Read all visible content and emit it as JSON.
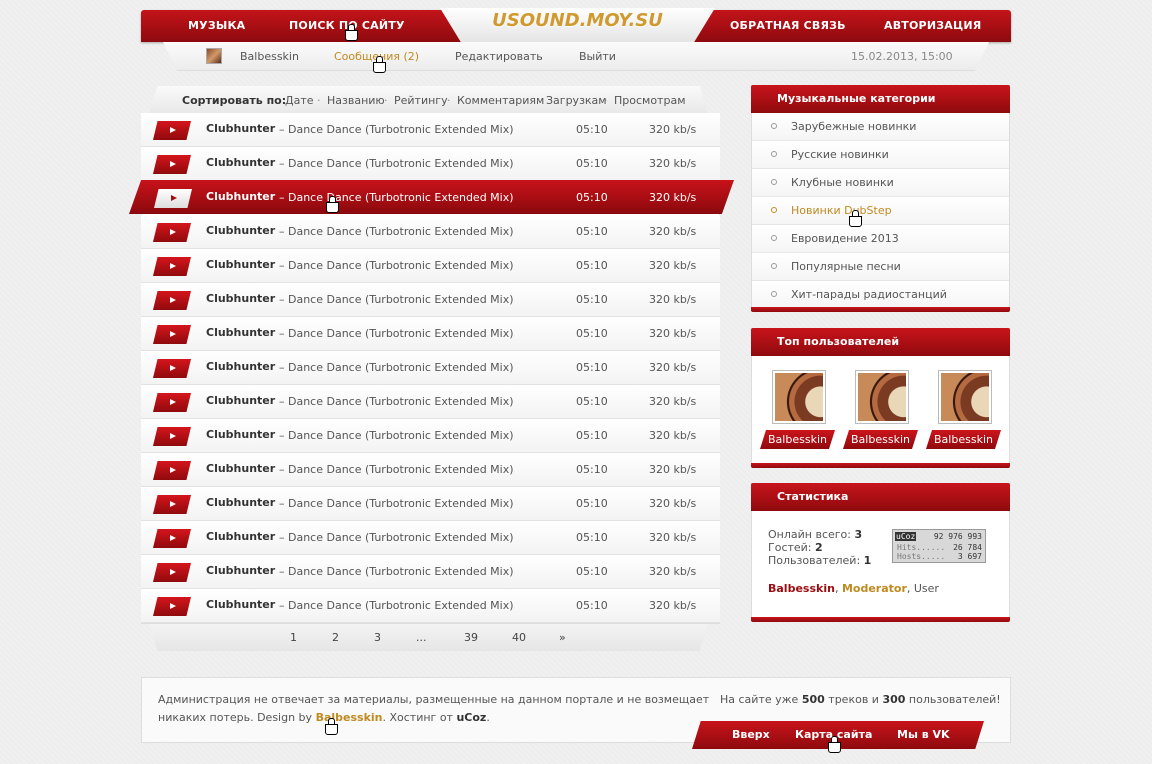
{
  "nav": {
    "music": "МУЗЫКА",
    "search": "ПОИСК ПО САЙТУ",
    "logo": "USOUND.MOY.SU",
    "feedback": "ОБРАТНАЯ СВЯЗЬ",
    "auth": "АВТОРИЗАЦИЯ"
  },
  "userbar": {
    "username": "Balbesskin",
    "messages": "Сообщения (2)",
    "edit": "Редактировать",
    "logout": "Выйти",
    "datetime": "15.02.2013, 15:00"
  },
  "sort": {
    "label": "Сортировать по:",
    "options": [
      "Дате",
      "Названию",
      "Рейтингу",
      "Комментариям",
      "Загрузкам",
      "Просмотрам"
    ]
  },
  "tracks": [
    {
      "artist": "Clubhunter",
      "title": "– Dance Dance (Turbotronic Extended Mix)",
      "duration": "05:10",
      "bitrate": "320 kb/s"
    },
    {
      "artist": "Clubhunter",
      "title": "– Dance Dance (Turbotronic Extended Mix)",
      "duration": "05:10",
      "bitrate": "320 kb/s"
    },
    {
      "artist": "Clubhunter",
      "title": "– Dance Dance (Turbotronic Extended Mix)",
      "duration": "05:10",
      "bitrate": "320 kb/s",
      "active": true
    },
    {
      "artist": "Clubhunter",
      "title": "– Dance Dance (Turbotronic Extended Mix)",
      "duration": "05:10",
      "bitrate": "320 kb/s"
    },
    {
      "artist": "Clubhunter",
      "title": "– Dance Dance (Turbotronic Extended Mix)",
      "duration": "05:10",
      "bitrate": "320 kb/s"
    },
    {
      "artist": "Clubhunter",
      "title": "– Dance Dance (Turbotronic Extended Mix)",
      "duration": "05:10",
      "bitrate": "320 kb/s"
    },
    {
      "artist": "Clubhunter",
      "title": "– Dance Dance (Turbotronic Extended Mix)",
      "duration": "05:10",
      "bitrate": "320 kb/s"
    },
    {
      "artist": "Clubhunter",
      "title": "– Dance Dance (Turbotronic Extended Mix)",
      "duration": "05:10",
      "bitrate": "320 kb/s"
    },
    {
      "artist": "Clubhunter",
      "title": "– Dance Dance (Turbotronic Extended Mix)",
      "duration": "05:10",
      "bitrate": "320 kb/s"
    },
    {
      "artist": "Clubhunter",
      "title": "– Dance Dance (Turbotronic Extended Mix)",
      "duration": "05:10",
      "bitrate": "320 kb/s"
    },
    {
      "artist": "Clubhunter",
      "title": "– Dance Dance (Turbotronic Extended Mix)",
      "duration": "05:10",
      "bitrate": "320 kb/s"
    },
    {
      "artist": "Clubhunter",
      "title": "– Dance Dance (Turbotronic Extended Mix)",
      "duration": "05:10",
      "bitrate": "320 kb/s"
    },
    {
      "artist": "Clubhunter",
      "title": "– Dance Dance (Turbotronic Extended Mix)",
      "duration": "05:10",
      "bitrate": "320 kb/s"
    },
    {
      "artist": "Clubhunter",
      "title": "– Dance Dance (Turbotronic Extended Mix)",
      "duration": "05:10",
      "bitrate": "320 kb/s"
    },
    {
      "artist": "Clubhunter",
      "title": "– Dance Dance (Turbotronic Extended Mix)",
      "duration": "05:10",
      "bitrate": "320 kb/s"
    }
  ],
  "pager": [
    "1",
    "2",
    "3",
    "...",
    "39",
    "40",
    "»"
  ],
  "categories": {
    "title": "Музыкальные категории",
    "items": [
      "Зарубежные новинки",
      "Русские новинки",
      "Клубные новинки",
      "Новинки DubStep",
      "Евровидение 2013",
      "Популярные песни",
      "Хит-парады радиостанций"
    ]
  },
  "top_users": {
    "title": "Топ пользователей",
    "users": [
      "Balbesskin",
      "Balbesskin",
      "Balbesskin"
    ]
  },
  "stats": {
    "title": "Статистика",
    "online_label": "Онлайн всего:",
    "online": "3",
    "guests_label": "Гостей:",
    "guests": "2",
    "users_label": "Пользователей:",
    "users": "1",
    "list_admin": "Balbesskin",
    "list_sep1": ",",
    "list_mod": "Moderator",
    "list_rest": ", User",
    "counter": {
      "brand": "uCoz",
      "total": "92 976 993",
      "hits_label": "Hits......",
      "hits": "26 784",
      "hosts_label": "Hosts.....",
      "hosts": "3 697"
    }
  },
  "footer": {
    "disclaimer1": "Администрация не отвечает за материалы, размещенные на данном портале и не возмещает",
    "disclaimer2": "никаких потерь. Design by",
    "designer": "Balbesskin",
    "hosting": ". Хостинг от",
    "host": "uCoz",
    "host_end": ".",
    "stats_a": "На сайте уже",
    "tracks": "500",
    "stats_b": "треков и",
    "users": "300",
    "stats_c": "пользователей!",
    "nav": {
      "up": "Вверх",
      "sitemap": "Карта сайта",
      "vk": "Мы в VK"
    }
  },
  "colors": {
    "accent": "#b10f15",
    "gold": "#c08a20"
  }
}
